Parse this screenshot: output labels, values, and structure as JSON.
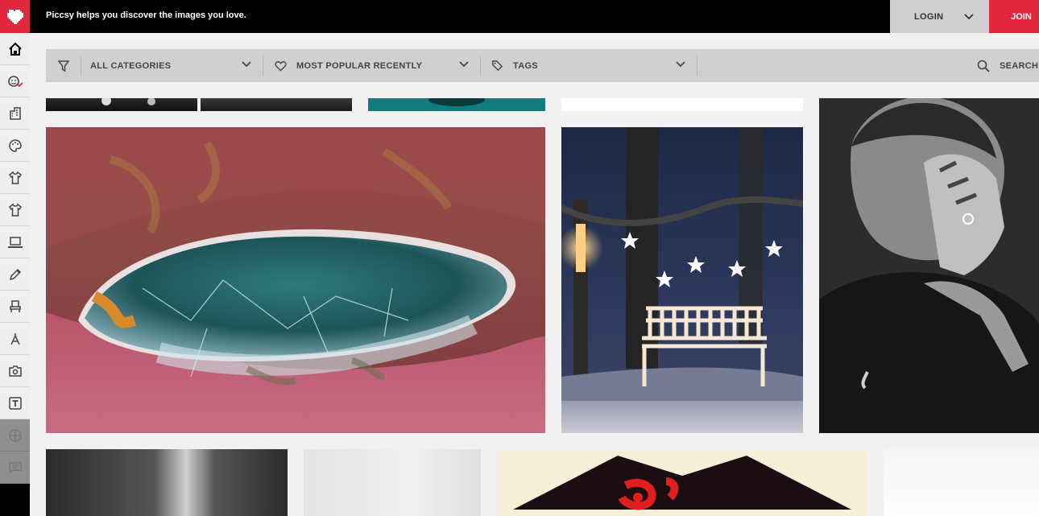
{
  "header": {
    "tagline": "Piccsy helps you discover the images you love.",
    "login_label": "LOGIN",
    "join_label": "JOIN"
  },
  "filters": {
    "categories_label": "ALL CATEGORIES",
    "sort_label": "MOST POPULAR RECENTLY",
    "tags_label": "TAGS",
    "search_label": "SEARCH"
  },
  "sidebar": {
    "items": [
      {
        "icon": "home-icon"
      },
      {
        "icon": "face-check-icon"
      },
      {
        "icon": "building-icon"
      },
      {
        "icon": "palette-icon"
      },
      {
        "icon": "shirt-icon"
      },
      {
        "icon": "tshirt-icon"
      },
      {
        "icon": "laptop-icon"
      },
      {
        "icon": "pencil-icon"
      },
      {
        "icon": "chair-icon"
      },
      {
        "icon": "compass-icon"
      },
      {
        "icon": "camera-icon"
      },
      {
        "icon": "text-icon"
      },
      {
        "icon": "globe-icon"
      },
      {
        "icon": "chat-icon"
      }
    ]
  },
  "colors": {
    "brand_red": "#e0273b",
    "bar_gray": "#d0d0d0",
    "background": "#f1f1f1"
  }
}
